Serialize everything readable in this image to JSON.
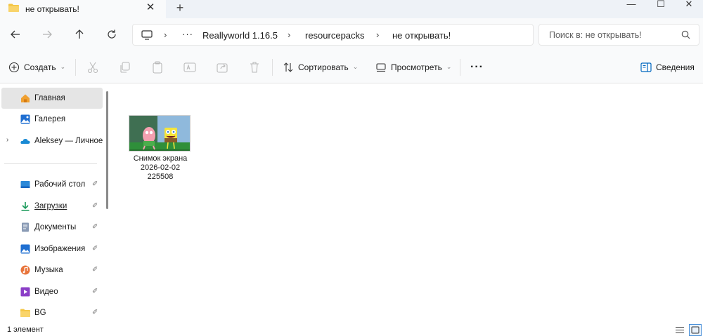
{
  "tab": {
    "title": "не открывать!",
    "close": "✕",
    "new": "+"
  },
  "window": {
    "minimize": "—",
    "maximize": "☐",
    "close": "✕"
  },
  "nav": {
    "breadcrumb": [
      "Reallyworld 1.16.5",
      "resourcepacks",
      "не открывать!"
    ],
    "more": "···",
    "search_placeholder": "Поиск в: не открывать!"
  },
  "toolbar": {
    "create": "Создать",
    "sort": "Сортировать",
    "view": "Просмотреть",
    "more": "···",
    "details": "Сведения"
  },
  "sidebar": {
    "items": [
      {
        "label": "Главная",
        "icon": "home-icon",
        "selected": true
      },
      {
        "label": "Галерея",
        "icon": "gallery-icon"
      },
      {
        "label": "Aleksey — Личное",
        "icon": "onedrive-icon",
        "expandable": true
      },
      {
        "label": "Рабочий стол",
        "icon": "desktop-icon",
        "pinned": true
      },
      {
        "label": "Загрузки",
        "icon": "downloads-icon",
        "pinned": true
      },
      {
        "label": "Документы",
        "icon": "documents-icon",
        "pinned": true
      },
      {
        "label": "Изображения",
        "icon": "pictures-icon",
        "pinned": true
      },
      {
        "label": "Музыка",
        "icon": "music-icon",
        "pinned": true
      },
      {
        "label": "Видео",
        "icon": "video-icon",
        "pinned": true
      },
      {
        "label": "BG",
        "icon": "folder-icon",
        "pinned": true
      }
    ]
  },
  "files": [
    {
      "name_lines": [
        "Снимок экрана",
        "2026-02-02",
        "225508"
      ]
    }
  ],
  "status": {
    "count": "1 элемент"
  },
  "colors": {
    "accent": "#0067c0",
    "folder": "#f4c542",
    "selected_bg": "#e5e5e5"
  }
}
